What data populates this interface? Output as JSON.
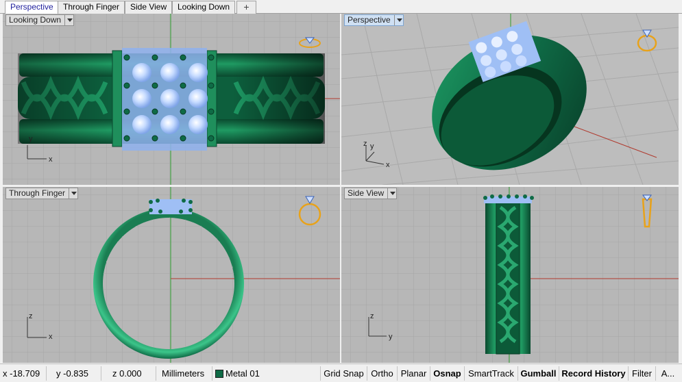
{
  "tabs": [
    {
      "label": "Perspective",
      "active": true
    },
    {
      "label": "Through Finger",
      "active": false
    },
    {
      "label": "Side View",
      "active": false
    },
    {
      "label": "Looking Down",
      "active": false
    }
  ],
  "add_tab_glyph": "+",
  "viewports": {
    "top_left": {
      "label": "Looking Down",
      "axis_a": "y",
      "axis_b": "x"
    },
    "top_right": {
      "label": "Perspective",
      "axis_a": "z",
      "axis_b": "y",
      "axis_c": "x"
    },
    "bottom_left": {
      "label": "Through Finger",
      "axis_a": "z",
      "axis_b": "x"
    },
    "bottom_right": {
      "label": "Side View",
      "axis_a": "z",
      "axis_b": "y"
    }
  },
  "status": {
    "x": "x -18.709",
    "y": "y -0.835",
    "z": "z 0.000",
    "units": "Millimeters",
    "layer": "Metal 01",
    "buttons": [
      "Grid Snap",
      "Ortho",
      "Planar",
      "Osnap",
      "SmartTrack",
      "Gumball",
      "Record History",
      "Filter",
      "A..."
    ]
  },
  "colors": {
    "metal": "#0f6b46",
    "gem": "#a9c7ff",
    "grid_bg": "#b7b7b7",
    "x_axis": "#b03a2e",
    "y_axis": "#2e9c2e",
    "ring_icon": "#e8a21a"
  }
}
